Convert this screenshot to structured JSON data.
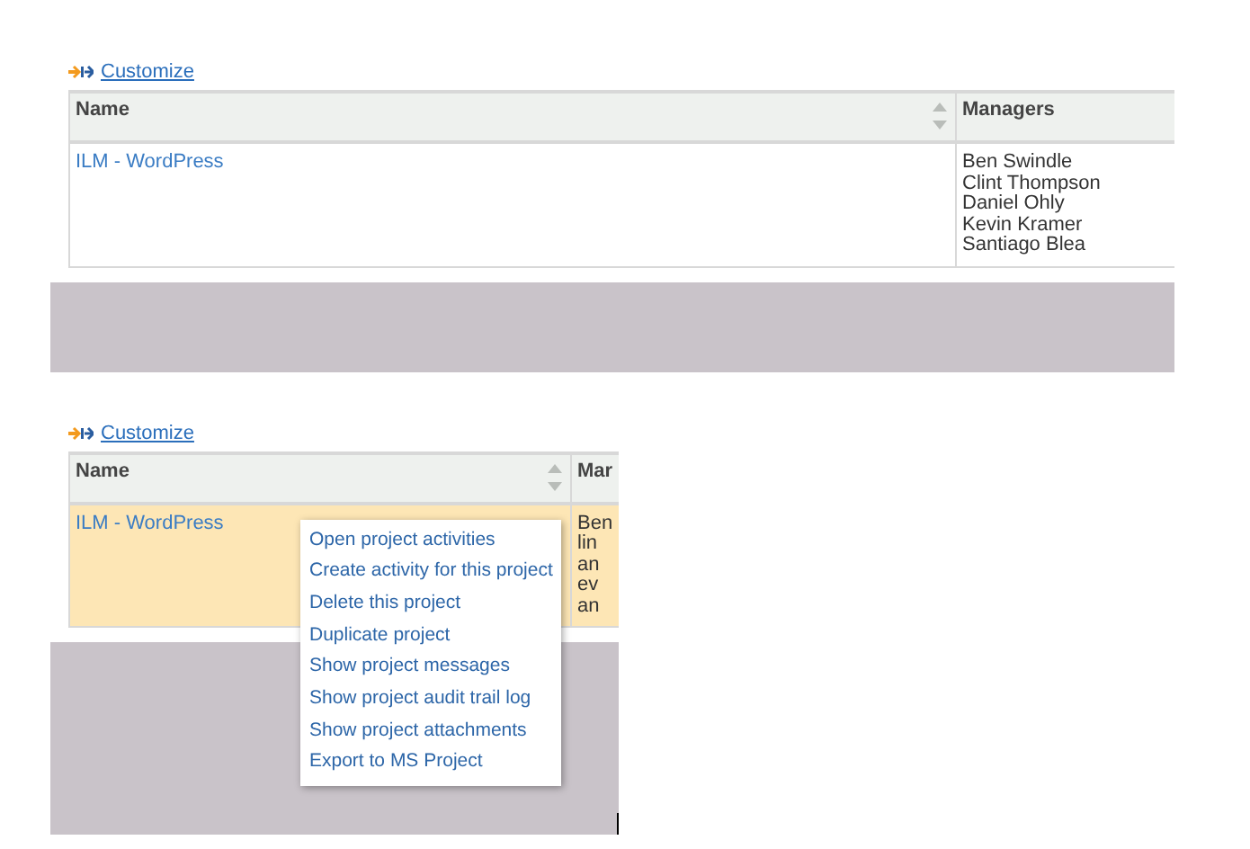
{
  "panels": [
    {
      "customize_link": "Customize",
      "columns": [
        "Name",
        "Managers"
      ],
      "rows": [
        {
          "name": "ILM - WordPress",
          "selected": false,
          "managers": [
            "Ben Swindle",
            "Clint Thompson",
            "Daniel Ohly",
            "Kevin Kramer",
            "Santiago Blea"
          ]
        }
      ]
    },
    {
      "customize_link": "Customize",
      "columns": [
        "Name",
        "Mar"
      ],
      "rows": [
        {
          "name": "ILM - WordPress",
          "selected": true,
          "managers": [
            "Ben",
            "lin",
            "an",
            "ev",
            "an"
          ]
        }
      ],
      "context_menu": [
        "Open project activities",
        "Create activity for this project",
        "Delete this project",
        "Duplicate project",
        "Show project messages",
        "Show project audit trail log",
        "Show project attachments",
        "Export to MS Project"
      ]
    }
  ]
}
